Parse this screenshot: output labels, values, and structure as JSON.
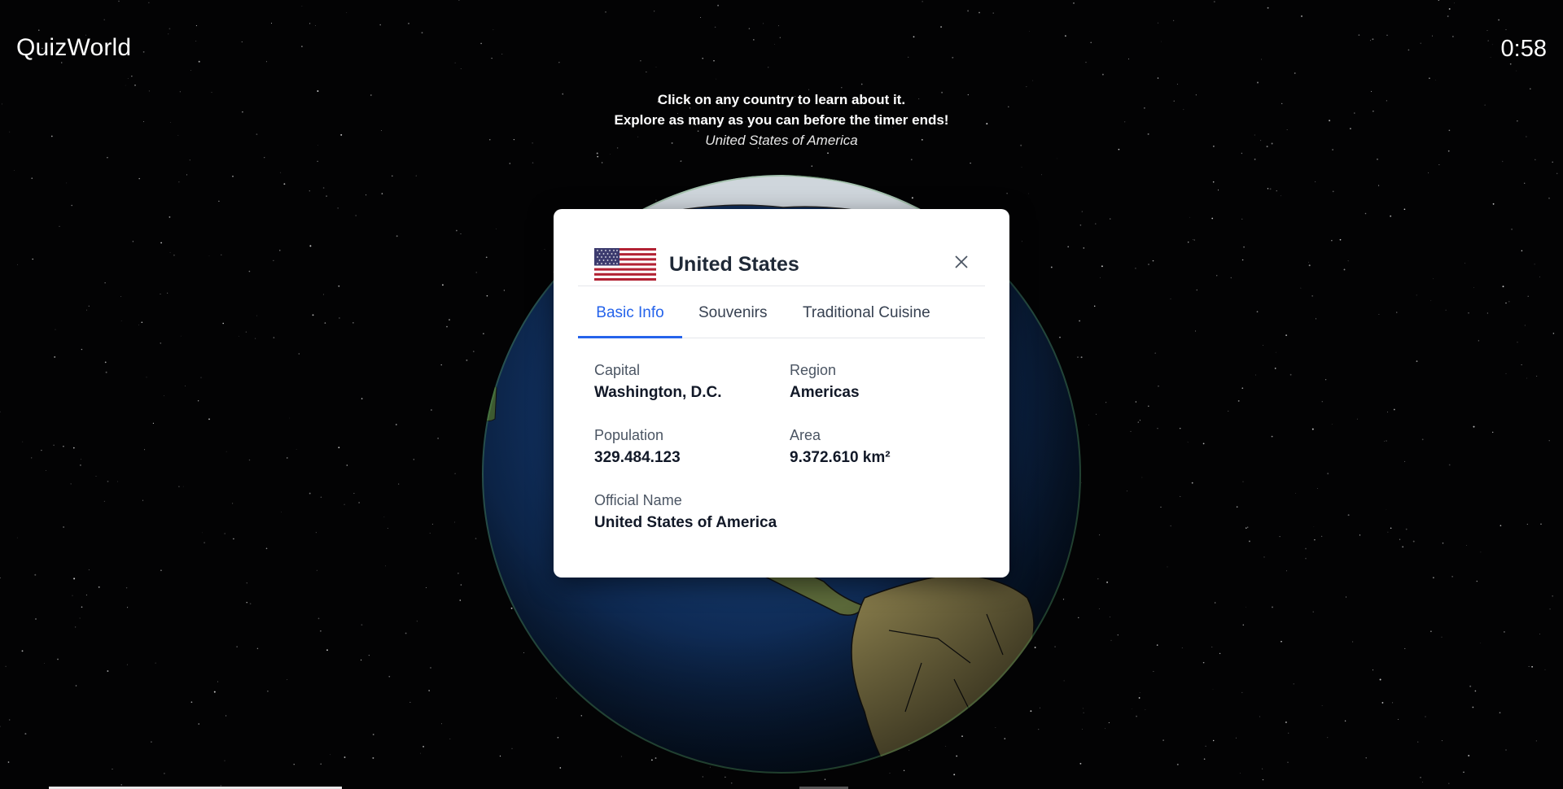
{
  "app": {
    "title": "QuizWorld",
    "timer": "0:58"
  },
  "instructions": {
    "line1": "Click on any country to learn about it.",
    "line2": "Explore as many as you can before the timer ends!",
    "hovered_country": "United States of America"
  },
  "globe": {
    "icon": "earth-globe"
  },
  "modal": {
    "country_name": "United States",
    "flag_icon": "us-flag-icon",
    "close_icon": "close-icon",
    "tabs": [
      {
        "label": "Basic Info",
        "active": true
      },
      {
        "label": "Souvenirs",
        "active": false
      },
      {
        "label": "Traditional Cuisine",
        "active": false
      }
    ],
    "fields": {
      "capital": {
        "label": "Capital",
        "value": "Washington, D.C."
      },
      "region": {
        "label": "Region",
        "value": "Americas"
      },
      "population": {
        "label": "Population",
        "value": "329.484.123"
      },
      "area": {
        "label": "Area",
        "value": "9.372.610 km²"
      },
      "official_name": {
        "label": "Official Name",
        "value": "United States of America"
      }
    }
  },
  "colors": {
    "accent": "#2563eb",
    "background": "#030304",
    "ocean": "#0f2c57",
    "land": "#6b6a3a"
  }
}
